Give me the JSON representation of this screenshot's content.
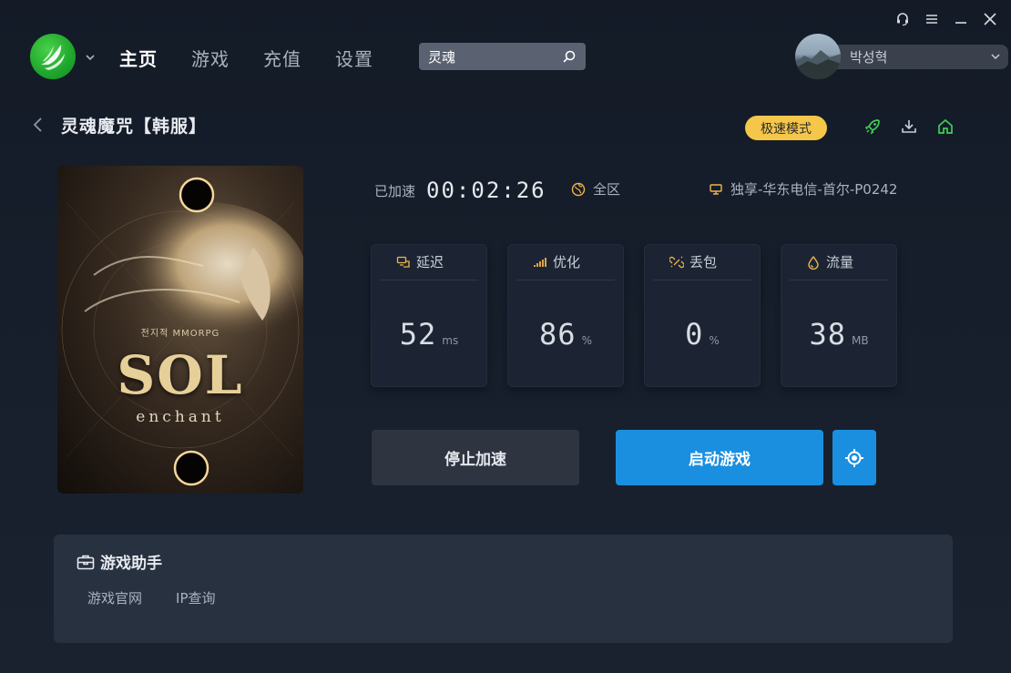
{
  "window_controls": {
    "icons": [
      "headset-icon",
      "menu-icon",
      "minimize-icon",
      "close-icon"
    ]
  },
  "header": {
    "nav": [
      {
        "label": "主页",
        "active": true
      },
      {
        "label": "游戏",
        "active": false
      },
      {
        "label": "充值",
        "active": false
      },
      {
        "label": "设置",
        "active": false
      }
    ],
    "search": {
      "value": "灵魂",
      "placeholder": ""
    },
    "user": {
      "name": "박성혁"
    }
  },
  "game": {
    "title": "灵魂魔咒【韩服】",
    "mode_badge": "极速模式",
    "poster": {
      "tagline": "전지적 MMORPG",
      "logo": "SOL",
      "subtitle": "enchant"
    }
  },
  "status": {
    "accelerated_label": "已加速",
    "timer": "00:02:26",
    "region": "全区",
    "server": "独享-华东电信-首尔-P0242"
  },
  "stats": [
    {
      "label": "延迟",
      "value": "52",
      "unit": "ms",
      "icon": "latency-icon"
    },
    {
      "label": "优化",
      "value": "86",
      "unit": "%",
      "icon": "signal-icon"
    },
    {
      "label": "丢包",
      "value": "0",
      "unit": "%",
      "icon": "broken-link-icon"
    },
    {
      "label": "流量",
      "value": "38",
      "unit": "MB",
      "icon": "drop-icon"
    }
  ],
  "buttons": {
    "stop": "停止加速",
    "start": "启动游戏"
  },
  "assistant": {
    "title": "游戏助手",
    "links": [
      "游戏官网",
      "IP查询"
    ]
  },
  "colors": {
    "accent_blue": "#1a8fe0",
    "badge_yellow": "#f4c64a",
    "icon_green": "#3fcf55"
  }
}
